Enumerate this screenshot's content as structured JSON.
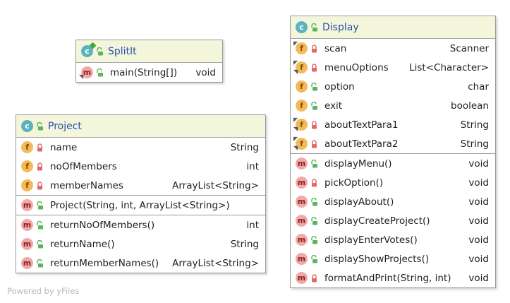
{
  "classes": {
    "splitit": {
      "name": "SplitIt",
      "methods": [
        {
          "name": "main(String[])",
          "type": "void",
          "icon": "method-icon",
          "visibility": "public",
          "static": true
        }
      ]
    },
    "project": {
      "name": "Project",
      "fields": [
        {
          "name": "name",
          "type": "String",
          "icon": "field-icon",
          "visibility": "private"
        },
        {
          "name": "noOfMembers",
          "type": "int",
          "icon": "field-icon",
          "visibility": "private"
        },
        {
          "name": "memberNames",
          "type": "ArrayList<String>",
          "icon": "field-icon",
          "visibility": "private"
        }
      ],
      "constructors": [
        {
          "name": "Project(String, int, ArrayList<String>)",
          "icon": "method-icon",
          "visibility": "public"
        }
      ],
      "methods": [
        {
          "name": "returnNoOfMembers()",
          "type": "int",
          "icon": "method-icon",
          "visibility": "public"
        },
        {
          "name": "returnName()",
          "type": "String",
          "icon": "method-icon",
          "visibility": "public"
        },
        {
          "name": "returnMemberNames()",
          "type": "ArrayList<String>",
          "icon": "method-icon",
          "visibility": "public"
        }
      ]
    },
    "display": {
      "name": "Display",
      "fields": [
        {
          "name": "scan",
          "type": "Scanner",
          "icon": "field-icon",
          "visibility": "private",
          "final": true
        },
        {
          "name": "menuOptions",
          "type": "List<Character>",
          "icon": "field-icon",
          "visibility": "private",
          "static": true,
          "final": true
        },
        {
          "name": "option",
          "type": "char",
          "icon": "field-icon",
          "visibility": "public"
        },
        {
          "name": "exit",
          "type": "boolean",
          "icon": "field-icon",
          "visibility": "public"
        },
        {
          "name": "aboutTextPara1",
          "type": "String",
          "icon": "field-icon",
          "visibility": "private",
          "static": true,
          "final": true
        },
        {
          "name": "aboutTextPara2",
          "type": "String",
          "icon": "field-icon",
          "visibility": "private",
          "static": true,
          "final": true
        }
      ],
      "methods": [
        {
          "name": "displayMenu()",
          "type": "void",
          "icon": "method-icon",
          "visibility": "public"
        },
        {
          "name": "pickOption()",
          "type": "void",
          "icon": "method-icon",
          "visibility": "private"
        },
        {
          "name": "displayAbout()",
          "type": "void",
          "icon": "method-icon",
          "visibility": "public"
        },
        {
          "name": "displayCreateProject()",
          "type": "void",
          "icon": "method-icon",
          "visibility": "public"
        },
        {
          "name": "displayEnterVotes()",
          "type": "void",
          "icon": "method-icon",
          "visibility": "public"
        },
        {
          "name": "displayShowProjects()",
          "type": "void",
          "icon": "method-icon",
          "visibility": "public"
        },
        {
          "name": "formatAndPrint(String, int)",
          "type": "void",
          "icon": "method-icon",
          "visibility": "private"
        }
      ]
    }
  },
  "colors": {
    "header_bg": "#f4f6dc",
    "class_name": "#2b4fa8",
    "class_badge": "#5ab2bf",
    "field_badge": "#f2ba5a",
    "method_badge": "#f1a8a8",
    "private_lock": "#e06a6a",
    "public_lock": "#5bb65b"
  },
  "watermark": "Powered by yFiles"
}
